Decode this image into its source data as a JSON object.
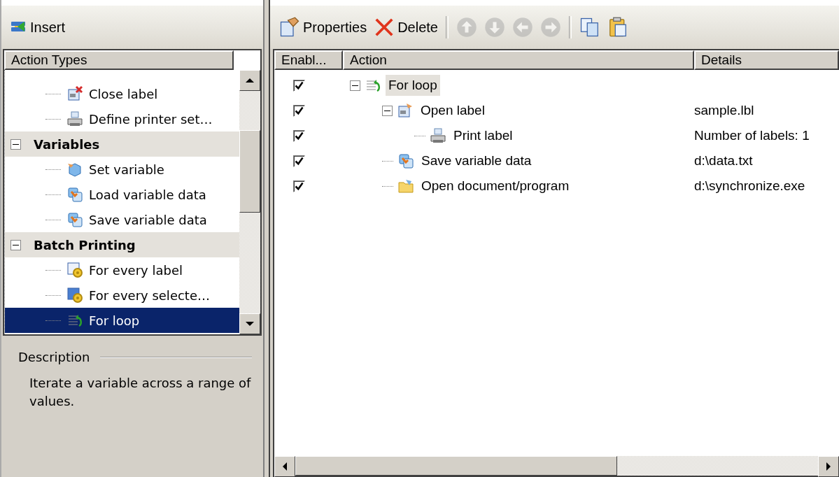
{
  "left_panel": {
    "insert_button": {
      "label": "Insert"
    },
    "tree_header": "Action Types",
    "tree": [
      {
        "children": [
          {
            "label": "Close label",
            "kind": "close",
            "selected": false
          },
          {
            "label": "Define printer set…",
            "kind": "printer",
            "selected": false
          }
        ]
      },
      {
        "label": "Variables",
        "expanded": true,
        "children": [
          {
            "label": "Set variable",
            "kind": "variable",
            "selected": false
          },
          {
            "label": "Load variable data",
            "kind": "load",
            "selected": false
          },
          {
            "label": "Save variable data",
            "kind": "save",
            "selected": false
          }
        ]
      },
      {
        "label": "Batch Printing",
        "expanded": true,
        "children": [
          {
            "label": "For every label",
            "kind": "batch",
            "selected": false
          },
          {
            "label": "For every selecte…",
            "kind": "batch-selected",
            "selected": false
          },
          {
            "label": "For loop",
            "kind": "loop",
            "selected": true
          }
        ]
      }
    ],
    "description": {
      "title": "Description",
      "text": "Iterate a variable across a range of values."
    }
  },
  "toolbar": [
    {
      "kind": "properties",
      "label": "Properties",
      "disabled": false
    },
    {
      "kind": "delete",
      "label": "Delete",
      "disabled": false
    },
    {
      "kind": "up",
      "disabled": true
    },
    {
      "kind": "down",
      "disabled": true
    },
    {
      "kind": "left",
      "disabled": true
    },
    {
      "kind": "right",
      "disabled": true
    },
    {
      "kind": "copy",
      "disabled": false
    },
    {
      "kind": "paste",
      "disabled": false
    }
  ],
  "actions": {
    "columns": [
      "Enabl...",
      "Action",
      "Details"
    ],
    "rows": [
      {
        "label": "For loop",
        "kind": "loop",
        "enabled": true,
        "selected": true,
        "details": "",
        "expanded": true,
        "children": [
          {
            "label": "Open label",
            "kind": "label",
            "enabled": true,
            "selected": false,
            "details": "sample.lbl",
            "expanded": true,
            "children": [
              {
                "label": "Print label",
                "kind": "printer",
                "enabled": true,
                "selected": false,
                "details": "Number of labels: 1"
              }
            ]
          },
          {
            "label": "Save variable data",
            "kind": "save",
            "enabled": true,
            "selected": false,
            "details": "d:\\data.txt"
          },
          {
            "label": "Open document/program",
            "kind": "document",
            "enabled": true,
            "selected": false,
            "details": "d:\\synchronize.exe"
          }
        ]
      }
    ]
  }
}
